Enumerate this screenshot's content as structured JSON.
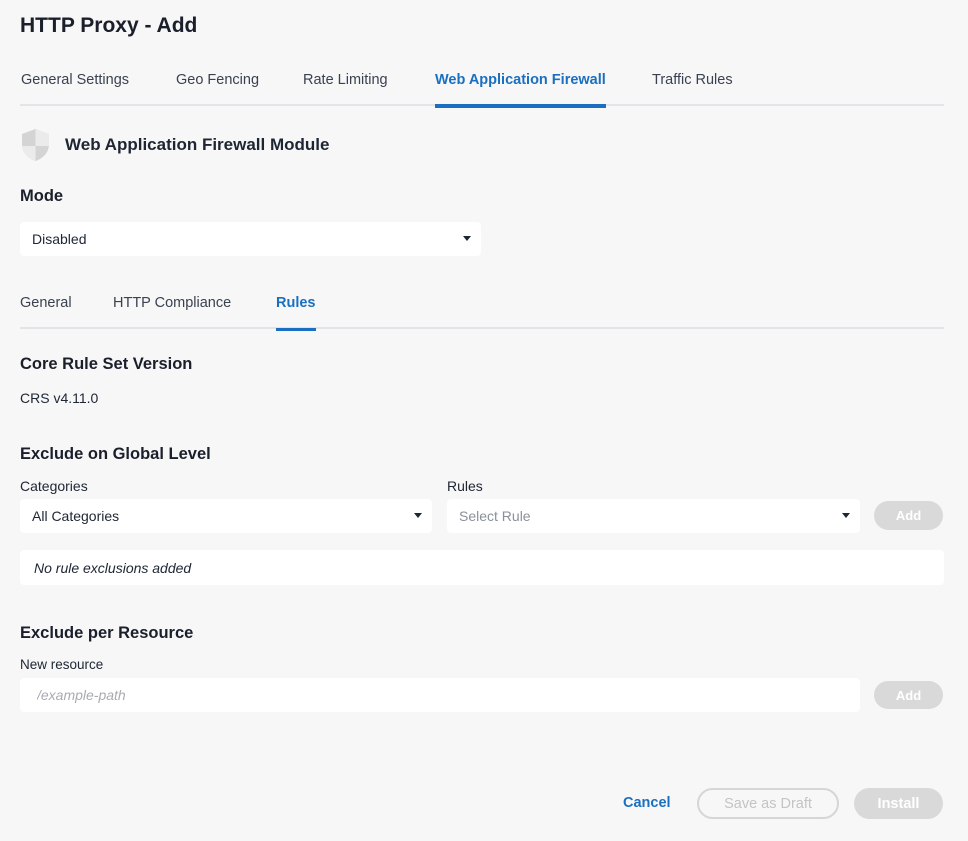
{
  "page_title": "HTTP Proxy - Add",
  "tabs": [
    {
      "label": "General Settings"
    },
    {
      "label": "Geo Fencing"
    },
    {
      "label": "Rate Limiting"
    },
    {
      "label": "Web Application Firewall"
    },
    {
      "label": "Traffic Rules"
    }
  ],
  "active_tab": "Web Application Firewall",
  "module": {
    "icon": "shield-icon",
    "title": "Web Application Firewall Module"
  },
  "mode": {
    "label": "Mode",
    "value": "Disabled"
  },
  "subtabs": [
    {
      "label": "General"
    },
    {
      "label": "HTTP Compliance"
    },
    {
      "label": "Rules"
    }
  ],
  "active_subtab": "Rules",
  "core_rule_set": {
    "heading": "Core Rule Set Version",
    "value": "CRS v4.11.0"
  },
  "exclude_global": {
    "heading": "Exclude on Global Level",
    "categories_label": "Categories",
    "categories_value": "All Categories",
    "rules_label": "Rules",
    "rules_placeholder": "Select Rule",
    "add_label": "Add",
    "empty_text": "No rule exclusions added"
  },
  "exclude_resource": {
    "heading": "Exclude per Resource",
    "new_resource_label": "New resource",
    "input_placeholder": "/example-path",
    "add_label": "Add"
  },
  "footer": {
    "cancel_label": "Cancel",
    "save_draft_label": "Save as Draft",
    "install_label": "Install"
  },
  "colors": {
    "accent": "#1a6fc0",
    "disabled_button": "#d9d9d9",
    "background": "#f7f7f7"
  }
}
